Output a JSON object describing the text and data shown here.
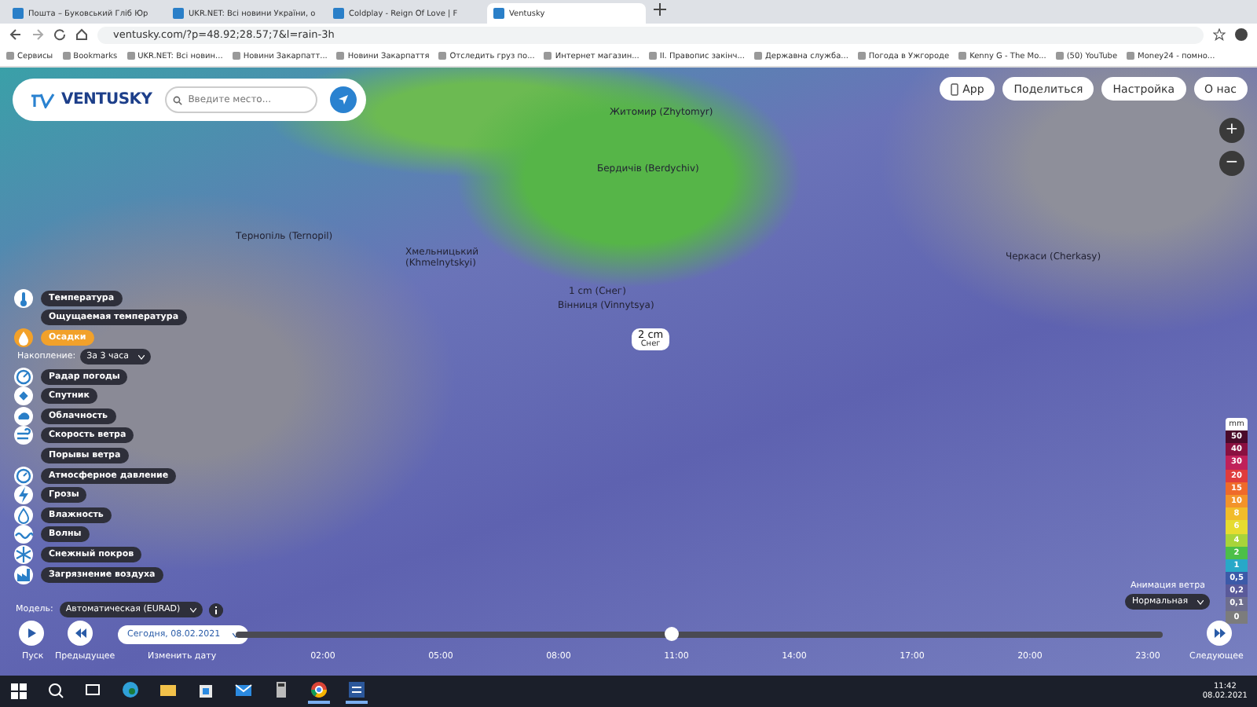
{
  "browser": {
    "tabs": [
      {
        "title": "Пошта – Буковський Гліб Юр",
        "selected": false
      },
      {
        "title": "UKR.NET: Всі новини України, о",
        "selected": false
      },
      {
        "title": "Coldplay - Reign Of Love | F",
        "selected": false
      },
      {
        "title": "Ventusky",
        "selected": true
      }
    ],
    "address": "ventusky.com/?p=48.92;28.57;7&l=rain-3h",
    "bookmarks": [
      "Сервисы",
      "Bookmarks",
      "UKR.NET: Всі новин...",
      "Новини Закарпатт...",
      "Новини Закарпаття",
      "Отследить груз по...",
      "Интернет магазин...",
      "ІІ. Правопис закінч...",
      "Державна служба...",
      "Погода в Ужгороде",
      "Kenny G - The Mo...",
      "(50) YouTube",
      "Money24 - помно..."
    ]
  },
  "header": {
    "logo": "VENTUSKY",
    "search_placeholder": "Введите место..."
  },
  "top_buttons": [
    "App",
    "Поделиться",
    "Настройка",
    "О нас"
  ],
  "zoom": [
    "+",
    "−"
  ],
  "map_labels": [
    {
      "text": "Житомир (Zhytomyr)"
    },
    {
      "text": "Бердичів (Berdychiv)"
    },
    {
      "text": "Хмельницький (Khmelnytskyi)"
    },
    {
      "text": "Тернопіль (Ternopil)"
    },
    {
      "text": "Черкаси (Cherkasy)"
    },
    {
      "text": "1 cm (Снег)"
    },
    {
      "text": "Вінниця (Vinnytsya)"
    }
  ],
  "popup": {
    "value": "2 cm",
    "label": "Снег"
  },
  "layers": [
    {
      "label": "Температура",
      "kind": "thermometer",
      "selected": false
    },
    {
      "label": "Ощущаемая температура",
      "kind": "sub",
      "selected": false
    },
    {
      "label": "Осадки",
      "kind": "drop",
      "selected": true,
      "option": {
        "label": "Накопление:",
        "value": "За 3 часа"
      }
    },
    {
      "label": "Радар погоды",
      "kind": "radar",
      "selected": false
    },
    {
      "label": "Спутник",
      "kind": "satellite",
      "selected": false
    },
    {
      "label": "Облачность",
      "kind": "cloud",
      "selected": false
    },
    {
      "label": "Скорость ветра",
      "kind": "wind",
      "selected": false
    },
    {
      "label": "Порывы ветра",
      "kind": "sub",
      "selected": false
    },
    {
      "label": "Атмосферное давление",
      "kind": "gauge",
      "selected": false
    },
    {
      "label": "Грозы",
      "kind": "lightning",
      "selected": false
    },
    {
      "label": "Влажность",
      "kind": "humidity",
      "selected": false
    },
    {
      "label": "Волны",
      "kind": "wave",
      "selected": false
    },
    {
      "label": "Снежный покров",
      "kind": "snowflake",
      "selected": false
    },
    {
      "label": "Загрязнение воздуха",
      "kind": "factory",
      "selected": false
    }
  ],
  "model": {
    "label": "Модель:",
    "value": "Автоматическая (EURAD)"
  },
  "wind_animation": {
    "label": "Анимация ветра",
    "value": "Нормальная"
  },
  "legend": {
    "unit": "mm",
    "items": [
      {
        "value": "50",
        "color": "#4a0a2a"
      },
      {
        "value": "40",
        "color": "#8a1040"
      },
      {
        "value": "30",
        "color": "#c0205a"
      },
      {
        "value": "20",
        "color": "#e03c3c"
      },
      {
        "value": "15",
        "color": "#ef6a2a"
      },
      {
        "value": "10",
        "color": "#f3932a"
      },
      {
        "value": "8",
        "color": "#f2bc2a"
      },
      {
        "value": "6",
        "color": "#e6dc30"
      },
      {
        "value": "4",
        "color": "#a8d43a"
      },
      {
        "value": "2",
        "color": "#4cbf48"
      },
      {
        "value": "1",
        "color": "#28a8c8"
      },
      {
        "value": "0,5",
        "color": "#3c5aa8"
      },
      {
        "value": "0,2",
        "color": "#5a5a9a"
      },
      {
        "value": "0,1",
        "color": "#6e6e8e"
      },
      {
        "value": "0",
        "color": "#7c7c7c"
      }
    ]
  },
  "timeline": {
    "play": "Пуск",
    "previous": "Предыдущее",
    "date": "Сегодня, 08.02.2021",
    "change_date": "Изменить дату",
    "next": "Следующее",
    "level": 0.47,
    "times": [
      "02:00",
      "05:00",
      "08:00",
      "11:00",
      "14:00",
      "17:00",
      "20:00",
      "23:00"
    ]
  },
  "taskbar": {
    "apps": [
      {
        "kind": "search",
        "active": false
      },
      {
        "kind": "taskview",
        "active": false
      },
      {
        "kind": "edge",
        "active": false
      },
      {
        "kind": "folder",
        "active": false
      },
      {
        "kind": "store",
        "active": false
      },
      {
        "kind": "mail",
        "active": false
      },
      {
        "kind": "calculator",
        "active": false
      },
      {
        "kind": "chrome",
        "active": true
      },
      {
        "kind": "word",
        "active": true
      }
    ],
    "time": "11:42",
    "date": "08.02.2021"
  }
}
